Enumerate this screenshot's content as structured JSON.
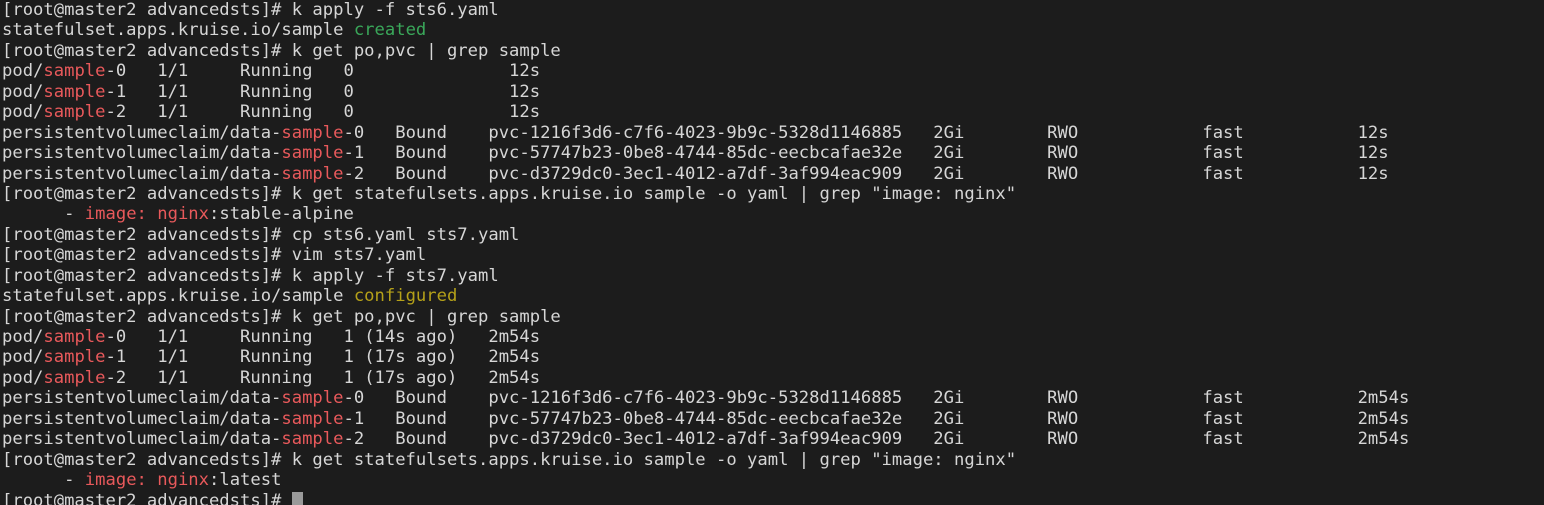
{
  "terminal": {
    "app": "terminal-emulator",
    "colors": {
      "background": "#1c1c1c",
      "foreground": "#d6d6d6",
      "red": "#e8595b",
      "green": "#3aa85a",
      "yellow": "#b5a119",
      "cursor": "#9a9a9a"
    },
    "prompt": "[root@master2 advancedsts]# ",
    "user": "root",
    "host": "master2",
    "cwd": "advancedsts",
    "cursor_visible": true,
    "lines": [
      {
        "id": "line-01",
        "kind": "command",
        "spans": [
          {
            "text": "[root@master2 advancedsts]# k apply -f sts6.yaml",
            "color": "default"
          }
        ]
      },
      {
        "id": "line-02",
        "kind": "output",
        "spans": [
          {
            "text": "statefulset.apps.kruise.io/sample ",
            "color": "default"
          },
          {
            "text": "created",
            "color": "green"
          }
        ]
      },
      {
        "id": "line-03",
        "kind": "command",
        "spans": [
          {
            "text": "[root@master2 advancedsts]# k get po,pvc | grep sample",
            "color": "default"
          }
        ]
      },
      {
        "id": "line-04",
        "kind": "output",
        "spans": [
          {
            "text": "pod/",
            "color": "default"
          },
          {
            "text": "sample",
            "color": "red"
          },
          {
            "text": "-0   1/1     Running   0               12s",
            "color": "default"
          }
        ]
      },
      {
        "id": "line-05",
        "kind": "output",
        "spans": [
          {
            "text": "pod/",
            "color": "default"
          },
          {
            "text": "sample",
            "color": "red"
          },
          {
            "text": "-1   1/1     Running   0               12s",
            "color": "default"
          }
        ]
      },
      {
        "id": "line-06",
        "kind": "output",
        "spans": [
          {
            "text": "pod/",
            "color": "default"
          },
          {
            "text": "sample",
            "color": "red"
          },
          {
            "text": "-2   1/1     Running   0               12s",
            "color": "default"
          }
        ]
      },
      {
        "id": "line-07",
        "kind": "output",
        "spans": [
          {
            "text": "persistentvolumeclaim/data-",
            "color": "default"
          },
          {
            "text": "sample",
            "color": "red"
          },
          {
            "text": "-0   Bound    pvc-1216f3d6-c7f6-4023-9b9c-5328d1146885   2Gi        RWO            fast           12s",
            "color": "default"
          }
        ]
      },
      {
        "id": "line-08",
        "kind": "output",
        "spans": [
          {
            "text": "persistentvolumeclaim/data-",
            "color": "default"
          },
          {
            "text": "sample",
            "color": "red"
          },
          {
            "text": "-1   Bound    pvc-57747b23-0be8-4744-85dc-eecbcafae32e   2Gi        RWO            fast           12s",
            "color": "default"
          }
        ]
      },
      {
        "id": "line-09",
        "kind": "output",
        "spans": [
          {
            "text": "persistentvolumeclaim/data-",
            "color": "default"
          },
          {
            "text": "sample",
            "color": "red"
          },
          {
            "text": "-2   Bound    pvc-d3729dc0-3ec1-4012-a7df-3af994eac909   2Gi        RWO            fast           12s",
            "color": "default"
          }
        ]
      },
      {
        "id": "line-10",
        "kind": "command",
        "spans": [
          {
            "text": "[root@master2 advancedsts]# k get statefulsets.apps.kruise.io sample -o yaml | grep \"image: nginx\"",
            "color": "default"
          }
        ]
      },
      {
        "id": "line-11",
        "kind": "output",
        "spans": [
          {
            "text": "      - ",
            "color": "default"
          },
          {
            "text": "image:",
            "color": "red"
          },
          {
            "text": " ",
            "color": "default"
          },
          {
            "text": "nginx",
            "color": "red"
          },
          {
            "text": ":stable-alpine",
            "color": "default"
          }
        ]
      },
      {
        "id": "line-12",
        "kind": "command",
        "spans": [
          {
            "text": "[root@master2 advancedsts]# cp sts6.yaml sts7.yaml",
            "color": "default"
          }
        ]
      },
      {
        "id": "line-13",
        "kind": "command",
        "spans": [
          {
            "text": "[root@master2 advancedsts]# vim sts7.yaml",
            "color": "default"
          }
        ]
      },
      {
        "id": "line-14",
        "kind": "command",
        "spans": [
          {
            "text": "[root@master2 advancedsts]# k apply -f sts7.yaml",
            "color": "default"
          }
        ]
      },
      {
        "id": "line-15",
        "kind": "output",
        "spans": [
          {
            "text": "statefulset.apps.kruise.io/sample ",
            "color": "default"
          },
          {
            "text": "configured",
            "color": "yellow"
          }
        ]
      },
      {
        "id": "line-16",
        "kind": "command",
        "spans": [
          {
            "text": "[root@master2 advancedsts]# k get po,pvc | grep sample",
            "color": "default"
          }
        ]
      },
      {
        "id": "line-17",
        "kind": "output",
        "spans": [
          {
            "text": "pod/",
            "color": "default"
          },
          {
            "text": "sample",
            "color": "red"
          },
          {
            "text": "-0   1/1     Running   1 (14s ago)   2m54s",
            "color": "default"
          }
        ]
      },
      {
        "id": "line-18",
        "kind": "output",
        "spans": [
          {
            "text": "pod/",
            "color": "default"
          },
          {
            "text": "sample",
            "color": "red"
          },
          {
            "text": "-1   1/1     Running   1 (17s ago)   2m54s",
            "color": "default"
          }
        ]
      },
      {
        "id": "line-19",
        "kind": "output",
        "spans": [
          {
            "text": "pod/",
            "color": "default"
          },
          {
            "text": "sample",
            "color": "red"
          },
          {
            "text": "-2   1/1     Running   1 (17s ago)   2m54s",
            "color": "default"
          }
        ]
      },
      {
        "id": "line-20",
        "kind": "output",
        "spans": [
          {
            "text": "persistentvolumeclaim/data-",
            "color": "default"
          },
          {
            "text": "sample",
            "color": "red"
          },
          {
            "text": "-0   Bound    pvc-1216f3d6-c7f6-4023-9b9c-5328d1146885   2Gi        RWO            fast           2m54s",
            "color": "default"
          }
        ]
      },
      {
        "id": "line-21",
        "kind": "output",
        "spans": [
          {
            "text": "persistentvolumeclaim/data-",
            "color": "default"
          },
          {
            "text": "sample",
            "color": "red"
          },
          {
            "text": "-1   Bound    pvc-57747b23-0be8-4744-85dc-eecbcafae32e   2Gi        RWO            fast           2m54s",
            "color": "default"
          }
        ]
      },
      {
        "id": "line-22",
        "kind": "output",
        "spans": [
          {
            "text": "persistentvolumeclaim/data-",
            "color": "default"
          },
          {
            "text": "sample",
            "color": "red"
          },
          {
            "text": "-2   Bound    pvc-d3729dc0-3ec1-4012-a7df-3af994eac909   2Gi        RWO            fast           2m54s",
            "color": "default"
          }
        ]
      },
      {
        "id": "line-23",
        "kind": "command",
        "spans": [
          {
            "text": "[root@master2 advancedsts]# k get statefulsets.apps.kruise.io sample -o yaml | grep \"image: nginx\"",
            "color": "default"
          }
        ]
      },
      {
        "id": "line-24",
        "kind": "output",
        "spans": [
          {
            "text": "      - ",
            "color": "default"
          },
          {
            "text": "image:",
            "color": "red"
          },
          {
            "text": " ",
            "color": "default"
          },
          {
            "text": "nginx",
            "color": "red"
          },
          {
            "text": ":latest",
            "color": "default"
          }
        ]
      },
      {
        "id": "line-25",
        "kind": "prompt",
        "cursor_after": 28,
        "spans": [
          {
            "text": "[root@master2 advancedsts]# ",
            "color": "default"
          }
        ]
      }
    ]
  }
}
